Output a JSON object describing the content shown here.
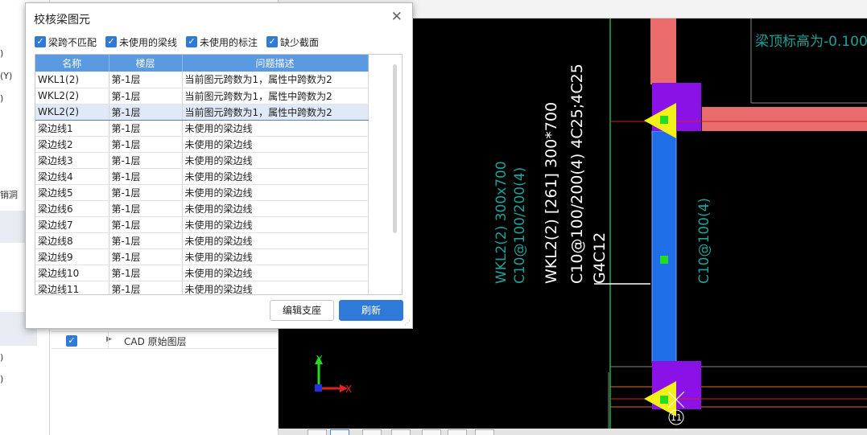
{
  "left_strip": {
    "items": [
      ")",
      "(Y)",
      ")",
      "销洞",
      ")",
      ")"
    ]
  },
  "layer_panel": {
    "row_label": "CAD 原始图层"
  },
  "dialog": {
    "title": "校核梁图元",
    "close_glyph": "✕",
    "filters": [
      {
        "label": "梁跨不匹配",
        "checked": true
      },
      {
        "label": "未使用的梁线",
        "checked": true
      },
      {
        "label": "未使用的标注",
        "checked": true
      },
      {
        "label": "缺少截面",
        "checked": true
      }
    ],
    "columns": [
      "名称",
      "楼层",
      "问题描述"
    ],
    "rows": [
      {
        "name": "WKL1(2)",
        "floor": "第-1层",
        "desc": "当前图元跨数为1，属性中跨数为2"
      },
      {
        "name": "WKL2(2)",
        "floor": "第-1层",
        "desc": "当前图元跨数为1，属性中跨数为2"
      },
      {
        "name": "WKL2(2)",
        "floor": "第-1层",
        "desc": "当前图元跨数为1，属性中跨数为2"
      },
      {
        "name": "梁边线1",
        "floor": "第-1层",
        "desc": "未使用的梁边线"
      },
      {
        "name": "梁边线2",
        "floor": "第-1层",
        "desc": "未使用的梁边线"
      },
      {
        "name": "梁边线3",
        "floor": "第-1层",
        "desc": "未使用的梁边线"
      },
      {
        "name": "梁边线4",
        "floor": "第-1层",
        "desc": "未使用的梁边线"
      },
      {
        "name": "梁边线5",
        "floor": "第-1层",
        "desc": "未使用的梁边线"
      },
      {
        "name": "梁边线6",
        "floor": "第-1层",
        "desc": "未使用的梁边线"
      },
      {
        "name": "梁边线7",
        "floor": "第-1层",
        "desc": "未使用的梁边线"
      },
      {
        "name": "梁边线8",
        "floor": "第-1层",
        "desc": "未使用的梁边线"
      },
      {
        "name": "梁边线9",
        "floor": "第-1层",
        "desc": "未使用的梁边线"
      },
      {
        "name": "梁边线10",
        "floor": "第-1层",
        "desc": "未使用的梁边线"
      },
      {
        "name": "梁边线11",
        "floor": "第-1层",
        "desc": "未使用的梁边线"
      }
    ],
    "selected_row": 2,
    "buttons": {
      "edit": "编辑支座",
      "refresh": "刷新"
    }
  },
  "cad": {
    "top_note": "梁顶标高为-0.100",
    "white_label_1": "WKL2(2) [261] 300*700",
    "white_label_2": "C10@100/200(4) 4C25;4C25",
    "white_label_3": "G4C12",
    "teal_label_1": "WKL2(2) 300x700",
    "teal_label_2": "C10@100/200(4)",
    "teal_label_3": "C10@100(4)",
    "axis_marker": "11",
    "ucs_y": "Y",
    "ucs_x": "X"
  },
  "colors": {
    "accent": "#2f7ad8",
    "header": "#5b9ae0",
    "beam_blue": "#1e6fe8",
    "beam_red": "#e96b6b",
    "column_purple": "#8b12e6",
    "support_yellow": "#f4f11a",
    "cad_teal": "#1aa39a",
    "cad_bg": "#000000"
  }
}
